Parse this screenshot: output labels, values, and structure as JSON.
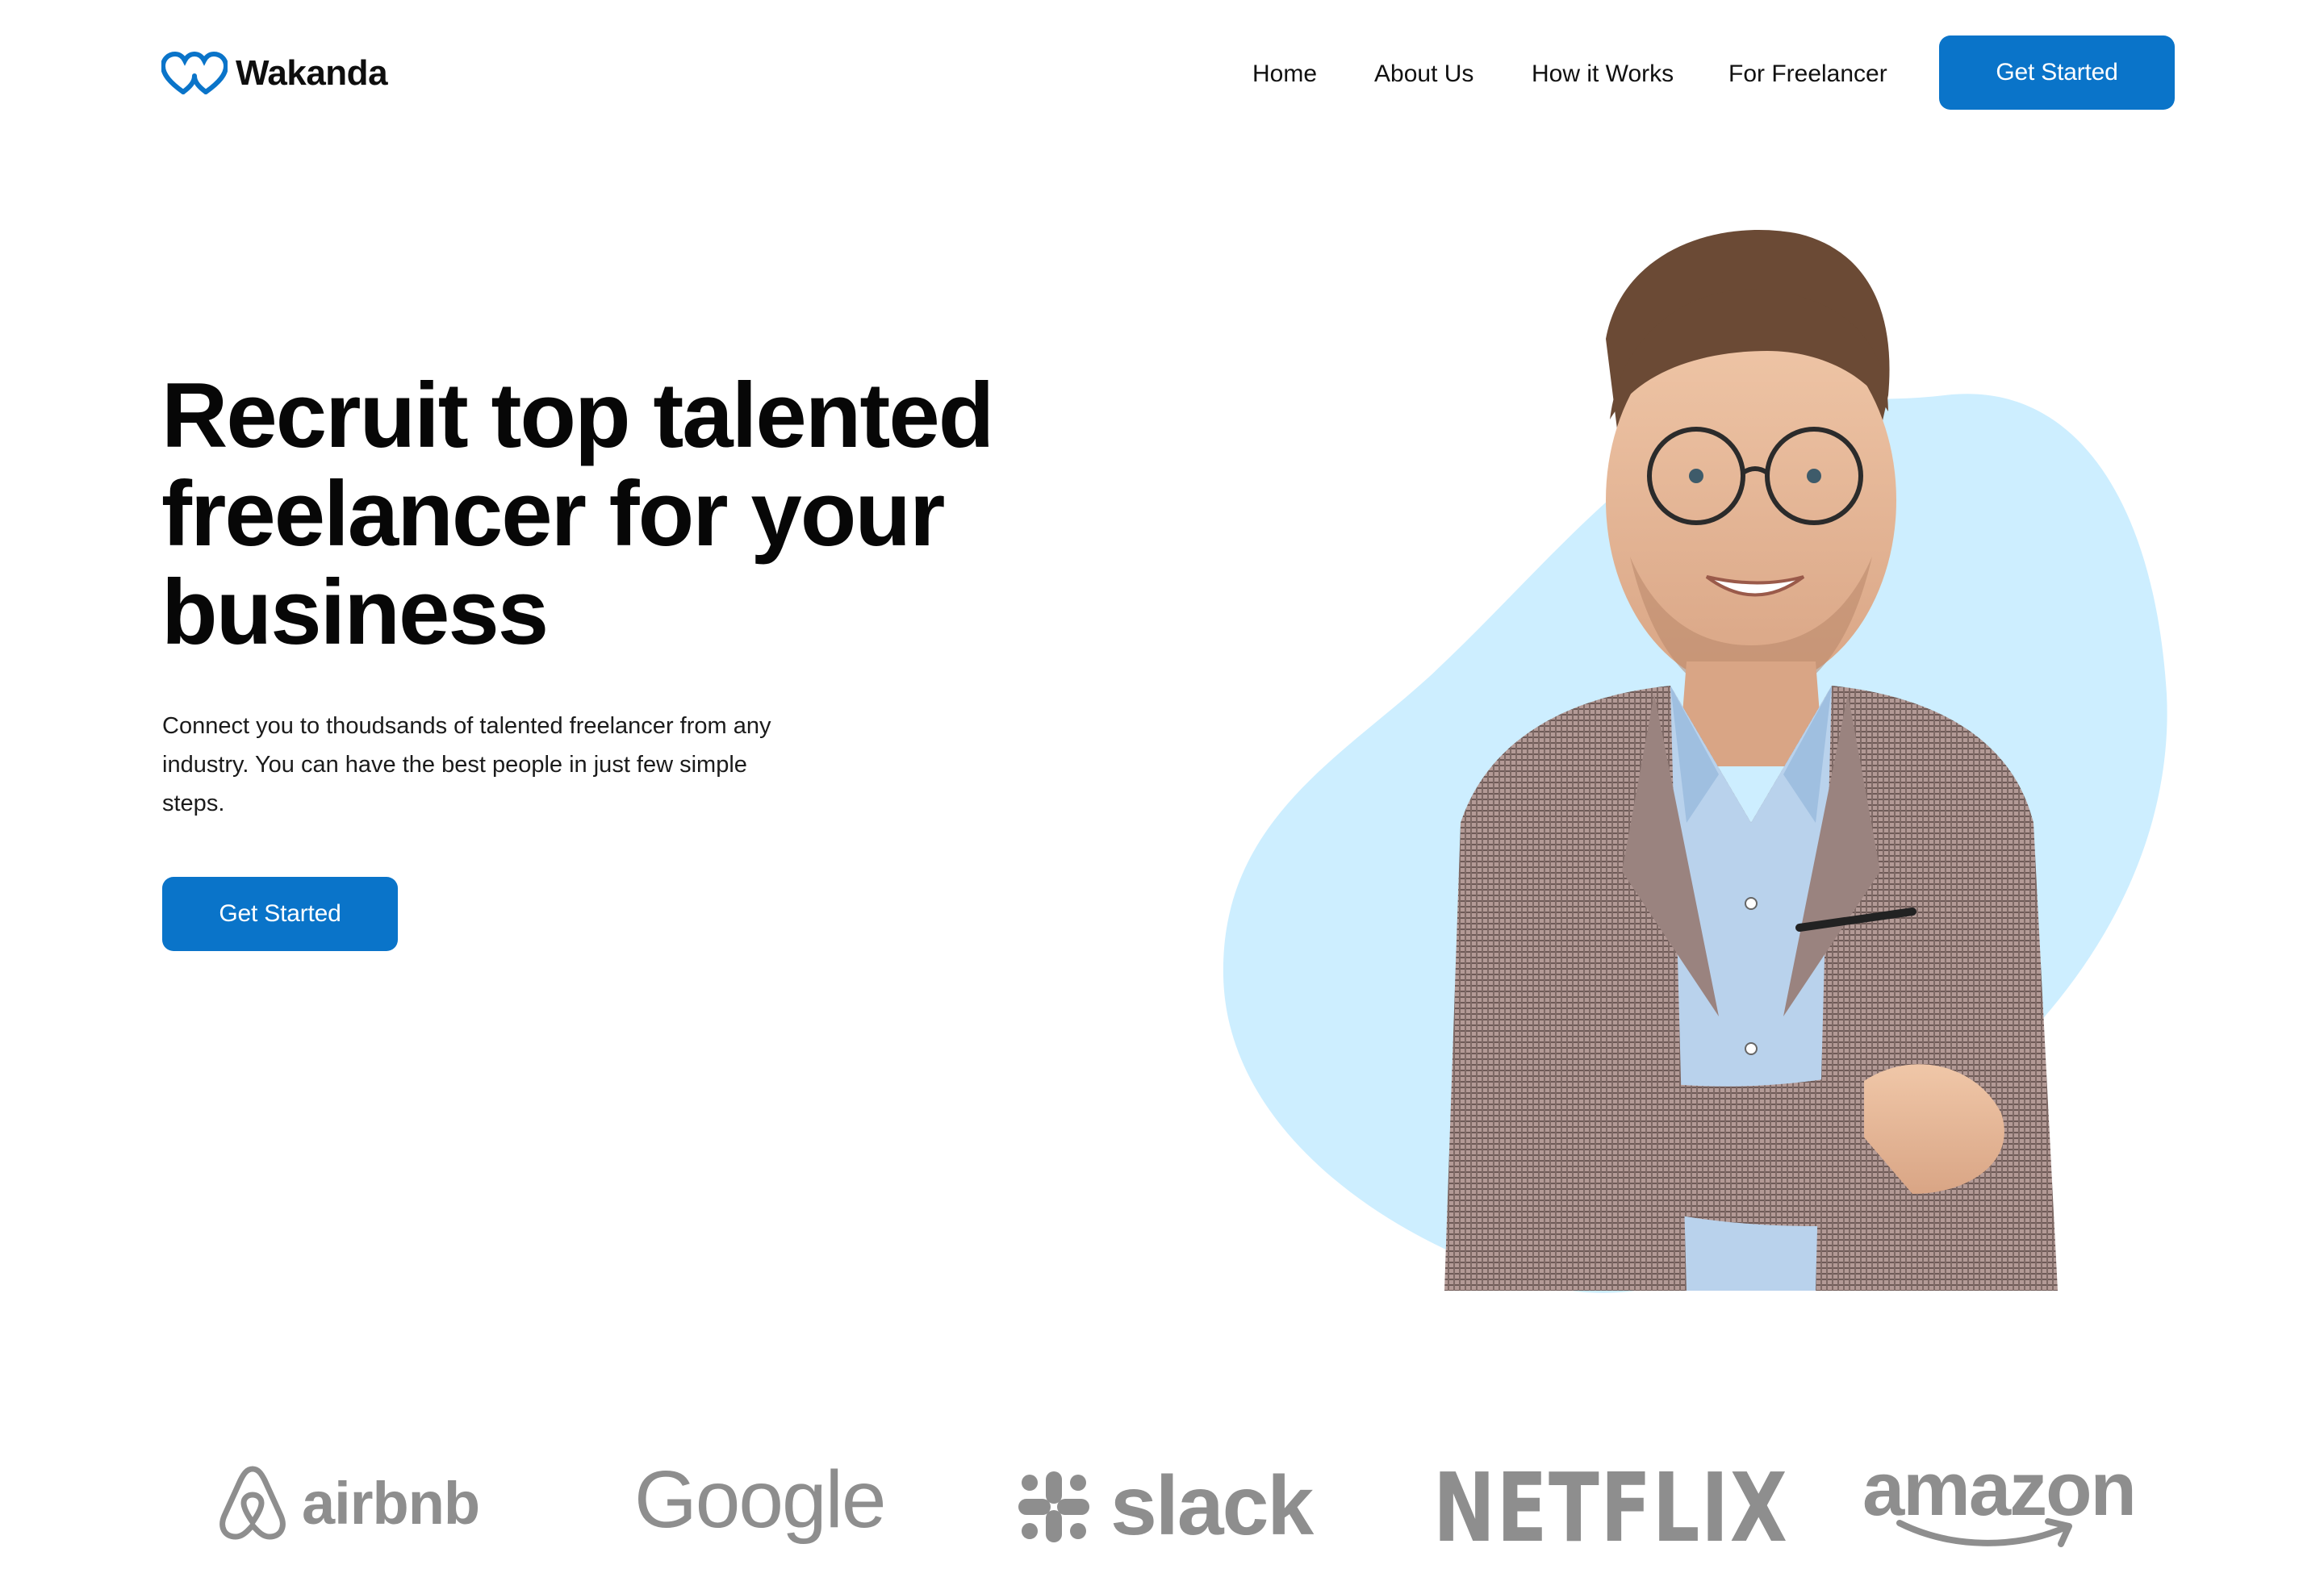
{
  "header": {
    "brand": "Wakanda",
    "nav": [
      "Home",
      "About Us",
      "How it Works",
      "For Freelancer"
    ],
    "cta": "Get Started"
  },
  "hero": {
    "title_lines": [
      "Recruit top talented",
      "freelancer for your",
      "business"
    ],
    "subtitle": "Connect you to thoudsands of talented freelancer from any industry. You can have the best people in just few simple steps.",
    "cta": "Get Started"
  },
  "brands": [
    "airbnb",
    "Google",
    "slack",
    "NETFLIX",
    "amazon"
  ],
  "colors": {
    "accent": "#0a74c9",
    "blob": "#cdeeff",
    "brand_gray": "#8e8e8e"
  }
}
